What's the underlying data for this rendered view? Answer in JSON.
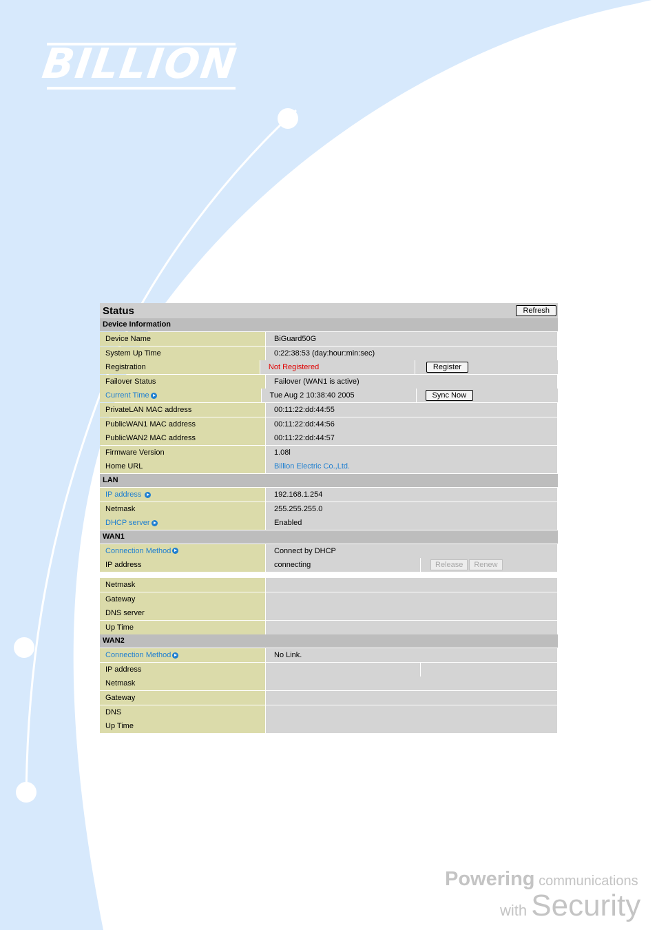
{
  "brand": {
    "logo": "BILLION",
    "tagline_1a": "Powering",
    "tagline_1b": " communications",
    "tagline_2a": "with ",
    "tagline_2b": "Security"
  },
  "colors": {
    "label_bg": "#dbdbaa",
    "value_bg": "#d4d4d4",
    "section_bg": "#bdbdbd",
    "link": "#1f7fd0",
    "alert": "#e00000",
    "background_swoosh": "#d7e9fc"
  },
  "header": {
    "title": "Status",
    "refresh_label": "Refresh"
  },
  "device": {
    "section": "Device Information",
    "device_name_label": "Device Name",
    "device_name": "BiGuard50G",
    "uptime_label": "System Up Time",
    "uptime": "0:22:38:53 (day:hour:min:sec)",
    "registration_label": "Registration",
    "registration": "Not Registered",
    "register_button": "Register",
    "failover_label": "Failover Status",
    "failover": "Failover (WAN1 is active)",
    "time_label": "Current Time",
    "time": "Tue Aug 2 10:38:40 2005",
    "sync_button": "Sync Now",
    "lan_mac_label": "PrivateLAN MAC address",
    "lan_mac": "00:11:22:dd:44:55",
    "wan1_mac_label": "PublicWAN1 MAC address",
    "wan1_mac": "00:11:22:dd:44:56",
    "wan2_mac_label": "PublicWAN2 MAC address",
    "wan2_mac": "00:11:22:dd:44:57",
    "firmware_label": "Firmware Version",
    "firmware": "1.08l",
    "home_label": "Home URL",
    "home": "Billion Electric Co.,Ltd."
  },
  "lan": {
    "section": "LAN",
    "ip_label": "IP address",
    "ip": "192.168.1.254",
    "netmask_label": "Netmask",
    "netmask": "255.255.255.0",
    "dhcp_label": "DHCP server",
    "dhcp": "Enabled"
  },
  "wan1": {
    "section": "WAN1",
    "method_label": "Connection Method",
    "method": "Connect by DHCP",
    "ip_label": "IP address",
    "ip": "connecting",
    "release_button": "Release",
    "renew_button": "Renew",
    "netmask_label": "Netmask",
    "gateway_label": "Gateway",
    "dns_label": "DNS server",
    "uptime_label": "Up Time"
  },
  "wan2": {
    "section": "WAN2",
    "method_label": "Connection Method",
    "method": "No Link.",
    "ip_label": "IP address",
    "netmask_label": "Netmask",
    "gateway_label": "Gateway",
    "dns_label": "DNS",
    "uptime_label": "Up Time"
  }
}
